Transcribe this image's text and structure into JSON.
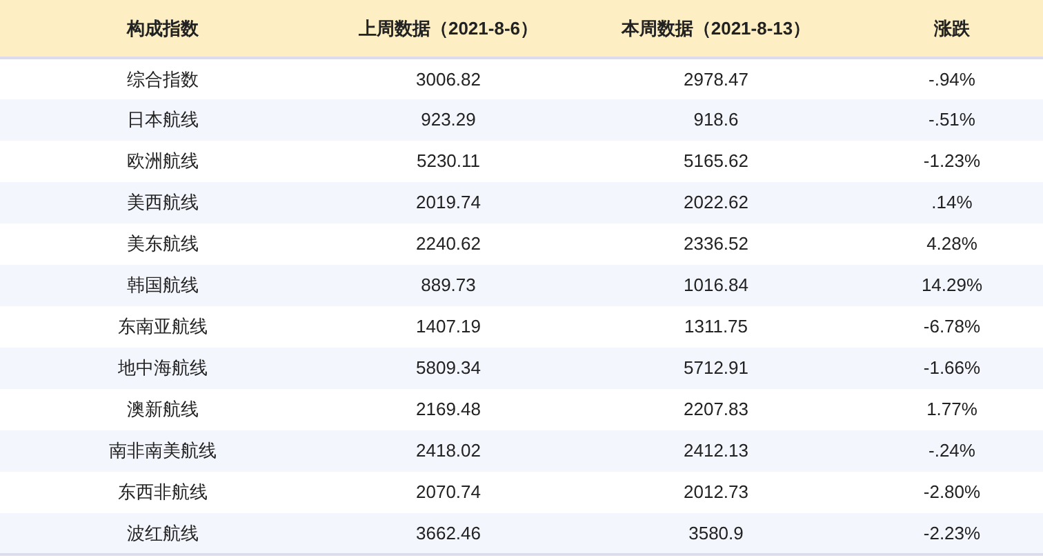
{
  "table": {
    "columns": [
      "构成指数",
      "上周数据（2021-8-6）",
      "本周数据（2021-8-13）",
      "涨跌"
    ],
    "rows": [
      [
        "综合指数",
        "3006.82",
        "2978.47",
        "-.94%"
      ],
      [
        "日本航线",
        "923.29",
        "918.6",
        "-.51%"
      ],
      [
        "欧洲航线",
        "5230.11",
        "5165.62",
        "-1.23%"
      ],
      [
        "美西航线",
        "2019.74",
        "2022.62",
        ".14%"
      ],
      [
        "美东航线",
        "2240.62",
        "2336.52",
        "4.28%"
      ],
      [
        "韩国航线",
        "889.73",
        "1016.84",
        "14.29%"
      ],
      [
        "东南亚航线",
        "1407.19",
        "1311.75",
        "-6.78%"
      ],
      [
        "地中海航线",
        "5809.34",
        "5712.91",
        "-1.66%"
      ],
      [
        "澳新航线",
        "2169.48",
        "2207.83",
        "1.77%"
      ],
      [
        "南非南美航线",
        "2418.02",
        "2412.13",
        "-.24%"
      ],
      [
        "东西非航线",
        "2070.74",
        "2012.73",
        "-2.80%"
      ],
      [
        "波红航线",
        "3662.46",
        "3580.9",
        "-2.23%"
      ]
    ]
  }
}
